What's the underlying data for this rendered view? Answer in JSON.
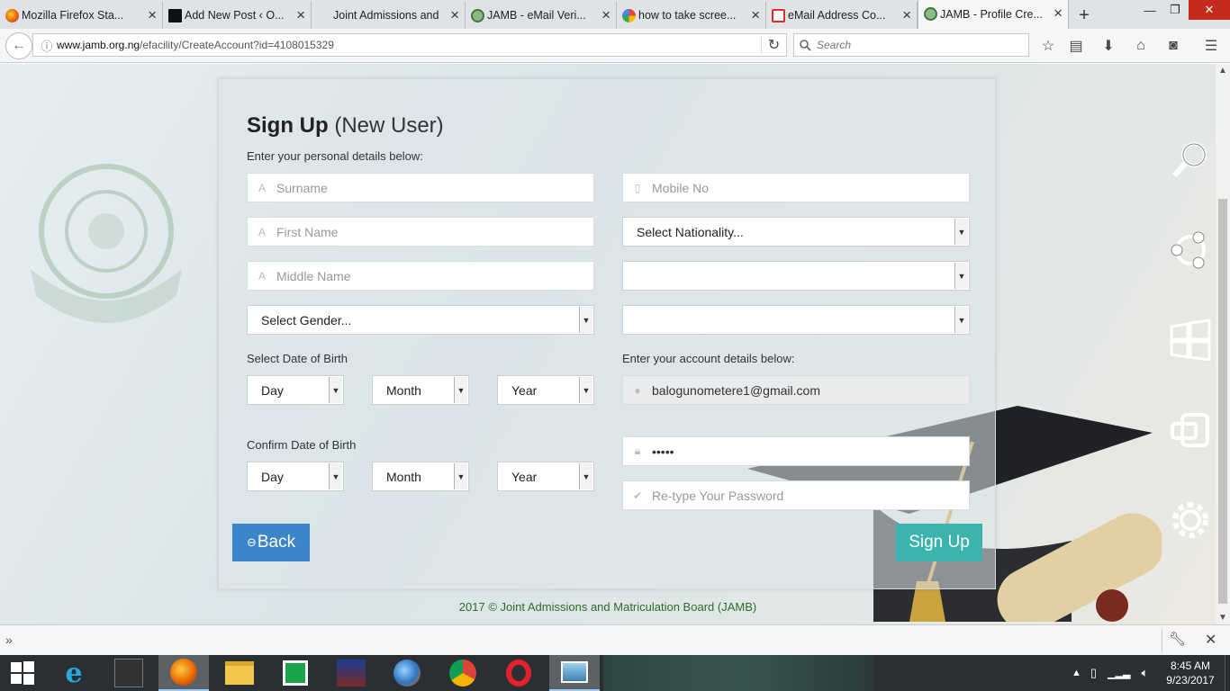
{
  "browser": {
    "tabs": [
      {
        "label": "Mozilla Firefox Sta...",
        "icon": "firefox-icon",
        "active": false
      },
      {
        "label": "Add New Post ‹ O...",
        "icon": "wordpress-site-icon",
        "active": false
      },
      {
        "label": "Joint Admissions and ...",
        "icon": "",
        "active": false
      },
      {
        "label": "JAMB - eMail Veri...",
        "icon": "jamb-icon",
        "active": false
      },
      {
        "label": "how to take scree...",
        "icon": "google-icon",
        "active": false
      },
      {
        "label": "eMail Address Co...",
        "icon": "gmail-icon",
        "active": false
      },
      {
        "label": "JAMB - Profile Cre...",
        "icon": "jamb-icon",
        "active": true
      }
    ],
    "new_tab": "+",
    "url_host": "www.jamb.org.ng",
    "url_path": "/efacility/CreateAccount?id=4108015329",
    "search_placeholder": "Search",
    "controls": {
      "minimize": "—",
      "maximize": "❐",
      "close": "✕"
    }
  },
  "form": {
    "title_bold": "Sign Up",
    "title_rest": " (New User)",
    "personal_intro": "Enter your personal details below:",
    "surname_placeholder": "Surname",
    "firstname_placeholder": "First Name",
    "middlename_placeholder": "Middle Name",
    "gender_select": "Select Gender...",
    "mobile_placeholder": "Mobile No",
    "nationality_select": "Select Nationality...",
    "state_select": "",
    "lga_select": "",
    "dob_label": "Select Date of Birth",
    "confirm_dob_label": "Confirm Date of Birth",
    "day": "Day",
    "month": "Month",
    "year": "Year",
    "account_intro": "Enter your account details below:",
    "email_value": "balogunometere1@gmail.com",
    "password_value": "•••••",
    "retype_placeholder": "Re-type Your Password",
    "back_label": "Back",
    "signup_label": "Sign Up"
  },
  "footer": "2017 © Joint Admissions and Matriculation Board (JAMB)",
  "taskbar": {
    "time": "8:45 AM",
    "date": "9/23/2017"
  },
  "colors": {
    "back_button": "#3a86c8",
    "signup_button": "#3db3ad",
    "footer_text": "#2f6b2d"
  }
}
